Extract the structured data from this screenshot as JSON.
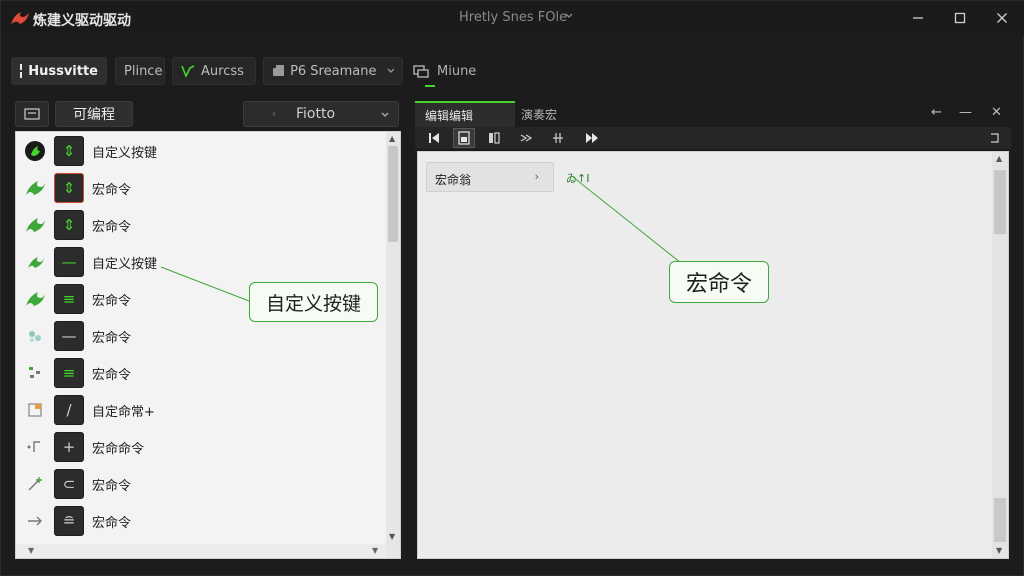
{
  "titlebar": {
    "app_title": "炼建义驱动驱动",
    "doc_title": "Hretly Snes FOle",
    "controls": [
      "minimize-icon",
      "maximize-icon",
      "close-icon"
    ]
  },
  "toolbar": {
    "buttons": [
      {
        "label": "Hussvitte",
        "icon": "grid-icon",
        "active": true
      },
      {
        "label": "Plince",
        "icon": "",
        "active": false
      },
      {
        "label": "Aurcss",
        "icon": "wave-icon",
        "active": false
      },
      {
        "label": "P6 Sreamane",
        "icon": "device-icon",
        "active": false
      },
      {
        "label": "Miune",
        "icon": "tag-icon",
        "active": false
      }
    ]
  },
  "left_panel": {
    "tab_label": "可编程",
    "dropdown_value": "Fiotto",
    "rows": [
      {
        "label": "自定义按键",
        "glyph": "⇕"
      },
      {
        "label": "宏命令",
        "glyph": "⇕"
      },
      {
        "label": "宏命令",
        "glyph": "⇕"
      },
      {
        "label": "自定义按键",
        "glyph": "—"
      },
      {
        "label": "宏命令",
        "glyph": "≡"
      },
      {
        "label": "宏命令",
        "glyph": "—"
      },
      {
        "label": "宏命令",
        "glyph": "≡"
      },
      {
        "label": "自定命常+",
        "glyph": "/"
      },
      {
        "label": "宏命命令",
        "glyph": "+"
      },
      {
        "label": "宏命令",
        "glyph": "⊂"
      },
      {
        "label": "宏命令",
        "glyph": "≘"
      }
    ],
    "callout": "自定义按键"
  },
  "right_panel": {
    "tabs": [
      "编辑编辑",
      "演奏宏"
    ],
    "dropdown_value": "宏命翁",
    "tag_text": "ゐ↑I",
    "callout": "宏命令"
  },
  "colors": {
    "accent": "#44d62c",
    "selection": "#d2472d",
    "dark_bg": "#1c1c1c"
  }
}
